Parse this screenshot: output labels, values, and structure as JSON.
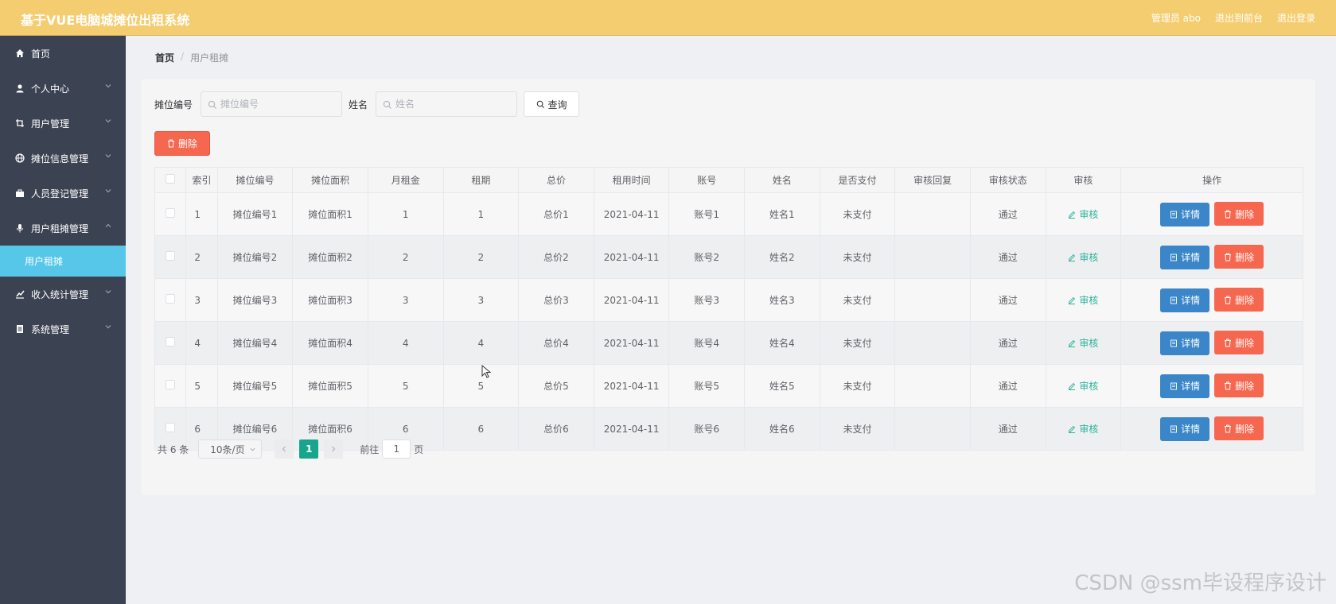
{
  "app": {
    "title": "基于VUE电脑城摊位出租系统"
  },
  "header": {
    "user": "管理员 abo",
    "back_front": "退出到前台",
    "logout": "退出登录"
  },
  "sidebar": {
    "items": [
      {
        "label": "首页",
        "icon": "home-icon"
      },
      {
        "label": "个人中心",
        "icon": "user-icon"
      },
      {
        "label": "用户管理",
        "icon": "crop-icon"
      },
      {
        "label": "摊位信息管理",
        "icon": "globe-icon"
      },
      {
        "label": "人员登记管理",
        "icon": "briefcase-icon"
      },
      {
        "label": "用户租摊管理",
        "icon": "microphone-icon"
      },
      {
        "label": "收入统计管理",
        "icon": "chart-icon"
      },
      {
        "label": "系统管理",
        "icon": "document-icon"
      }
    ],
    "active_sub": "用户租摊"
  },
  "breadcrumb": {
    "home": "首页",
    "separator": "/",
    "current": "用户租摊"
  },
  "search": {
    "field1_label": "摊位编号",
    "field1_placeholder": "摊位编号",
    "field2_label": "姓名",
    "field2_placeholder": "姓名",
    "query_label": "查询"
  },
  "toolbar": {
    "delete_label": "删除"
  },
  "table": {
    "columns": [
      "索引",
      "摊位编号",
      "摊位面积",
      "月租金",
      "租期",
      "总价",
      "租用时间",
      "账号",
      "姓名",
      "是否支付",
      "审核回复",
      "审核状态",
      "审核",
      "操作"
    ],
    "rows": [
      {
        "index": "1",
        "stall_no": "摊位编号1",
        "area": "摊位面积1",
        "rent": "1",
        "term": "1",
        "total": "总价1",
        "date": "2021-04-11",
        "account": "账号1",
        "name": "姓名1",
        "paid": "未支付",
        "reply": "",
        "status": "通过",
        "audit": "审核",
        "detail": "详情",
        "delete": "删除"
      },
      {
        "index": "2",
        "stall_no": "摊位编号2",
        "area": "摊位面积2",
        "rent": "2",
        "term": "2",
        "total": "总价2",
        "date": "2021-04-11",
        "account": "账号2",
        "name": "姓名2",
        "paid": "未支付",
        "reply": "",
        "status": "通过",
        "audit": "审核",
        "detail": "详情",
        "delete": "删除"
      },
      {
        "index": "3",
        "stall_no": "摊位编号3",
        "area": "摊位面积3",
        "rent": "3",
        "term": "3",
        "total": "总价3",
        "date": "2021-04-11",
        "account": "账号3",
        "name": "姓名3",
        "paid": "未支付",
        "reply": "",
        "status": "通过",
        "audit": "审核",
        "detail": "详情",
        "delete": "删除"
      },
      {
        "index": "4",
        "stall_no": "摊位编号4",
        "area": "摊位面积4",
        "rent": "4",
        "term": "4",
        "total": "总价4",
        "date": "2021-04-11",
        "account": "账号4",
        "name": "姓名4",
        "paid": "未支付",
        "reply": "",
        "status": "通过",
        "audit": "审核",
        "detail": "详情",
        "delete": "删除"
      },
      {
        "index": "5",
        "stall_no": "摊位编号5",
        "area": "摊位面积5",
        "rent": "5",
        "term": "5",
        "total": "总价5",
        "date": "2021-04-11",
        "account": "账号5",
        "name": "姓名5",
        "paid": "未支付",
        "reply": "",
        "status": "通过",
        "audit": "审核",
        "detail": "详情",
        "delete": "删除"
      },
      {
        "index": "6",
        "stall_no": "摊位编号6",
        "area": "摊位面积6",
        "rent": "6",
        "term": "6",
        "total": "总价6",
        "date": "2021-04-11",
        "account": "账号6",
        "name": "姓名6",
        "paid": "未支付",
        "reply": "",
        "status": "通过",
        "audit": "审核",
        "detail": "详情",
        "delete": "删除"
      }
    ]
  },
  "pagination": {
    "total": "共 6 条",
    "page_size": "10条/页",
    "current": "1",
    "goto_label": "前往",
    "goto_value": "1",
    "page_unit": "页"
  },
  "watermark": "CSDN @ssm毕设程序设计",
  "colors": {
    "header": "#f4cd70",
    "sidebar": "#3b4252",
    "active_sub": "#56c7e8",
    "primary": "#3a86c8",
    "danger": "#f5674f",
    "success": "#17a68b"
  }
}
